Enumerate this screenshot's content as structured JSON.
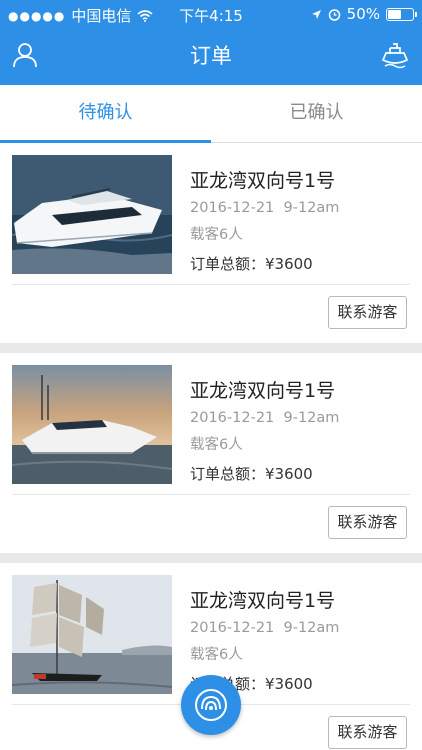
{
  "status_bar": {
    "carrier": "中国电信",
    "time": "下午4:15",
    "battery": "50%"
  },
  "nav": {
    "title": "订单",
    "left_icon": "user-icon",
    "right_icon": "boat-icon"
  },
  "tabs": [
    {
      "label": "待确认",
      "active": true
    },
    {
      "label": "已确认",
      "active": false
    }
  ],
  "orders": [
    {
      "title": "亚龙湾双向号1号",
      "date": "2016-12-21",
      "time_slot": "9-12am",
      "passengers": "载客6人",
      "total": "订单总额：¥3600",
      "action": "联系游客",
      "image": "white-yacht"
    },
    {
      "title": "亚龙湾双向号1号",
      "date": "2016-12-21",
      "time_slot": "9-12am",
      "passengers": "载客6人",
      "total": "订单总额：¥3600",
      "action": "联系游客",
      "image": "fishing-yacht-sunset"
    },
    {
      "title": "亚龙湾双向号1号",
      "date": "2016-12-21",
      "time_slot": "9-12am",
      "passengers": "载客6人",
      "total": "订单总额：¥3600",
      "action": "联系游客",
      "image": "sailboat"
    }
  ],
  "colors": {
    "primary": "#2d8fe5",
    "muted_text": "#9a9a9a",
    "background": "#e9e9e9"
  }
}
